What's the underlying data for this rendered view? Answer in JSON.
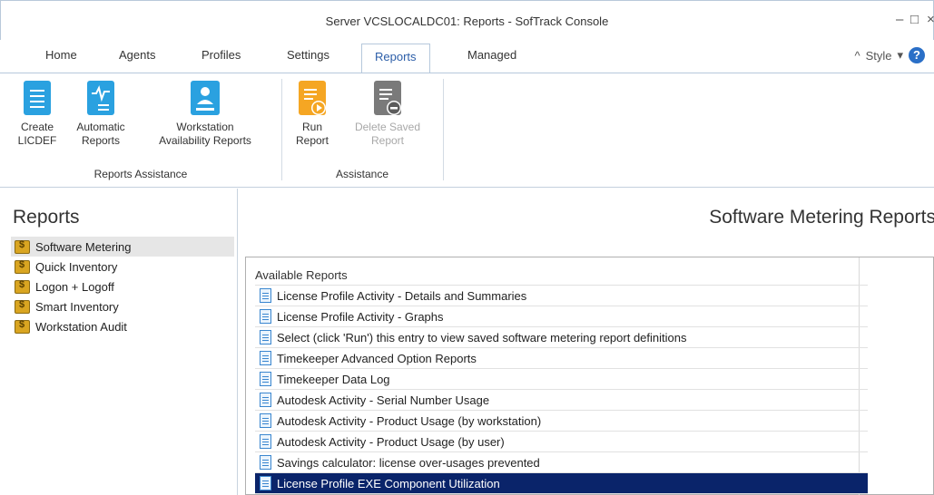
{
  "window": {
    "title": "Server VCSLOCALDC01: Reports - SofTrack Console",
    "minimize": "–",
    "maximize": "□",
    "close": "×"
  },
  "tabs": [
    {
      "label": "Home"
    },
    {
      "label": "Agents"
    },
    {
      "label": "Profiles"
    },
    {
      "label": "Settings"
    },
    {
      "label": "Reports"
    },
    {
      "label": "Managed"
    }
  ],
  "active_tab": "Reports",
  "style_menu": {
    "label": "Style",
    "caret_up": "^",
    "caret_down": "▾",
    "help": "?"
  },
  "ribbon": {
    "groups": [
      {
        "label": "Reports Assistance",
        "buttons": [
          {
            "line1": "Create",
            "line2": "LICDEF"
          },
          {
            "line1": "Automatic",
            "line2": "Reports"
          },
          {
            "line1": "Workstation",
            "line2": "Availability Reports"
          }
        ]
      },
      {
        "label": "Assistance",
        "buttons": [
          {
            "line1": "Run",
            "line2": "Report"
          },
          {
            "line1": "Delete Saved",
            "line2": "Report"
          }
        ]
      }
    ]
  },
  "left_panel": {
    "title": "Reports",
    "items": [
      {
        "label": "Software Metering"
      },
      {
        "label": "Quick Inventory"
      },
      {
        "label": "Logon + Logoff"
      },
      {
        "label": "Smart Inventory"
      },
      {
        "label": "Workstation Audit"
      }
    ],
    "selected": "Software Metering"
  },
  "main": {
    "title": "Software Metering Reports",
    "table_header": "Available Reports",
    "reports": [
      "License Profile Activity - Details and Summaries",
      "License Profile Activity - Graphs",
      "Select (click 'Run') this entry to view saved software metering report definitions",
      "Timekeeper Advanced Option Reports",
      "Timekeeper Data Log",
      "Autodesk Activity - Serial Number Usage",
      "Autodesk Activity - Product Usage (by workstation)",
      "Autodesk Activity - Product Usage (by user)",
      "Savings calculator: license over-usages prevented",
      "License Profile EXE Component Utilization"
    ],
    "selected_report": "License Profile EXE Component Utilization"
  },
  "colors": {
    "accent": "#2c5ea8",
    "selection": "#0a246a",
    "icon_blue": "#2aa1e0",
    "icon_orange": "#f5a623"
  }
}
